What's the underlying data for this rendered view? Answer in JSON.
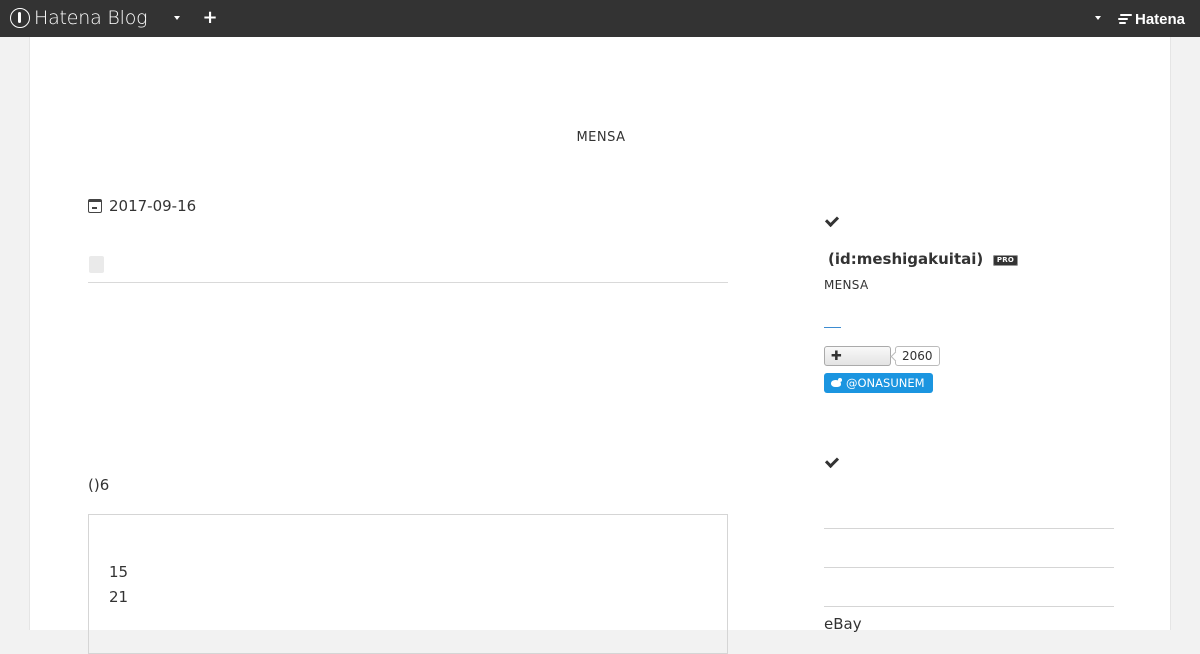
{
  "topbar": {
    "logo_text": "Hatena Blog",
    "brand_text": "Hatena",
    "logo_icon": "hatena-blog-logo-icon",
    "add_icon": "plus-icon",
    "dropdown_icon": "chevron-down-icon"
  },
  "blog": {
    "title": "MENSA"
  },
  "entry": {
    "date": "2017-09-16",
    "text": "()6",
    "box_lines": [
      "15",
      "21"
    ]
  },
  "sidebar": {
    "profile_id": "(id:meshigakuitai)",
    "pro_badge": "PRO",
    "profile_desc": "MENSA",
    "follow_count": "2060",
    "twitter_handle": "@ONASUNEM",
    "link_ebay": "eBay"
  },
  "colors": {
    "topbar": "#333333",
    "twitter": "#1b95e0",
    "accent_link": "#3d8cd1"
  }
}
